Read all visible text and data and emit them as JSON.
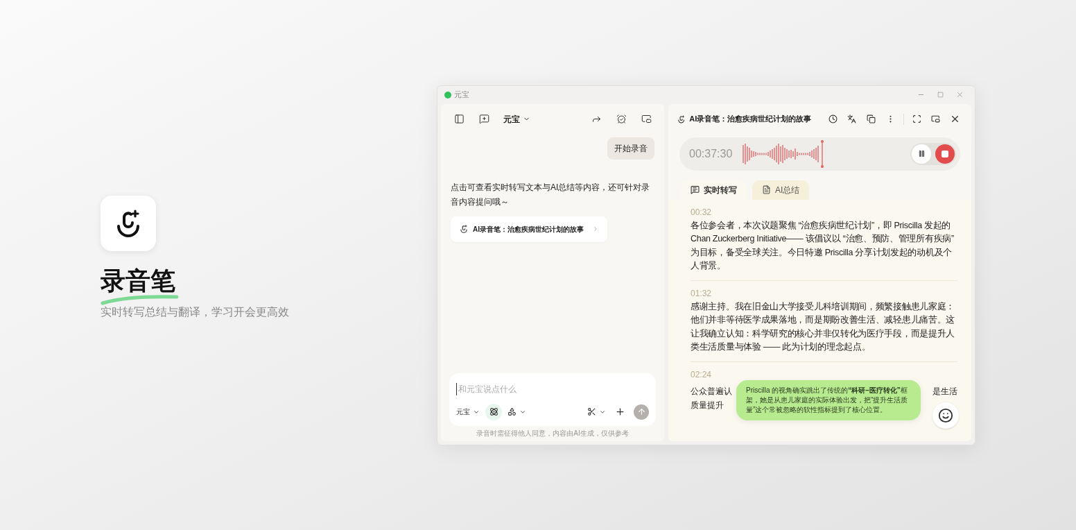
{
  "promo": {
    "title": "录音笔",
    "subtitle": "实时转写总结与翻译，学习开会更高效"
  },
  "window": {
    "title": "元宝"
  },
  "chat": {
    "model_menu": "元宝",
    "messages": [
      {
        "kind": "user",
        "text": "开始录音"
      },
      {
        "kind": "assistant",
        "text": "点击可查看实时转写文本与AI总结等内容，还可针对录音内容提问哦～"
      },
      {
        "kind": "card",
        "text": "AI录音笔：治愈疾病世纪计划的故事"
      }
    ],
    "input": {
      "placeholder": "和元宝说点什么",
      "model": "元宝"
    },
    "disclaimer": "录音时需征得他人同意，内容由AI生成，仅供参考"
  },
  "recorder": {
    "title": "AI录音笔：治愈疾病世纪计划的故事",
    "timer": "00:37:30",
    "tabs": [
      {
        "label": "实时转写",
        "selected": true
      },
      {
        "label": "AI总结",
        "selected": false
      }
    ],
    "segments": [
      {
        "kind": "full",
        "time": "00:32",
        "text": "各位参会者，本次议题聚焦 “治愈疾病世纪计划”，即 Priscilla 发起的 Chan Zuckerberg Initiative—— 该倡议以 “治愈、预防、管理所有疾病” 为目标，备受全球关注。今日特邀 Priscilla 分享计划发起的动机及个人背景。"
      },
      {
        "kind": "full",
        "time": "01:32",
        "text": "感谢主持。我在旧金山大学接受儿科培训期间，频繁接触患儿家庭：他们并非等待医学成果落地，而是期盼改善生活、减轻患儿痛苦。这让我确立认知：科学研究的核心并非仅转化为医疗手段，而是提升人类生活质量与体验 —— 此为计划的理念起点。"
      },
      {
        "kind": "covered",
        "time": "02:24",
        "fragments": [
          "公众普遍认",
          "是生活",
          "质量提升"
        ]
      }
    ],
    "bubble": {
      "text": "Priscilla 的视角确实跳出了传统的**“科研–医疗转化”**框架，她是从患儿家庭的实际体验出发，把“提升生活质量”这个常被忽略的软性指标提到了核心位置。"
    }
  }
}
